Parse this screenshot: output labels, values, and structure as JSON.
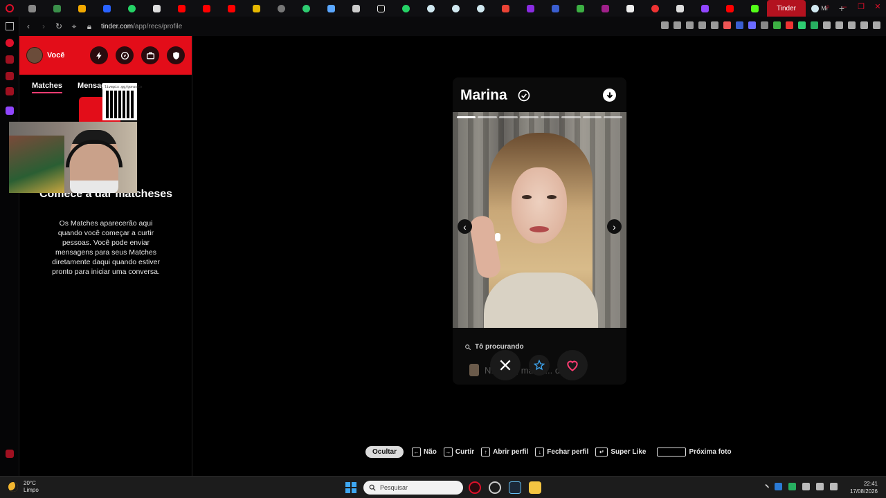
{
  "browser": {
    "active_tab": "Tinder",
    "last_tab": "Mi",
    "url_host": "tinder.com",
    "url_path": "/app/recs/profile"
  },
  "sidebar": {
    "user_label": "Você",
    "tabs": [
      "Matches",
      "Mensag"
    ],
    "empty_title": "Comece a dar matcheses",
    "empty_desc": "Os Matches aparecerão aqui quando você começar a curtir pessoas. Você pode enviar mensagens para seus Matches diretamente daqui quando estiver pronto para iniciar uma conversa.",
    "qr_label": "livepix.gg/gonzalo"
  },
  "profile": {
    "name": "Marina",
    "looking_label": "Tô procurando",
    "bio_preview": "N... ério, mas c... de...",
    "photo_count": 8,
    "current_photo": 1
  },
  "hints": {
    "hide": "Ocultar",
    "nope": "Não",
    "like": "Curtir",
    "open": "Abrir perfil",
    "close": "Fechar perfil",
    "super": "Super Like",
    "next": "Próxima foto"
  },
  "taskbar": {
    "temp": "20°C",
    "weather": "Limpo",
    "search_placeholder": "Pesquisar",
    "time": "22:41",
    "date": "17/08/2026"
  },
  "colors": {
    "brand": "#e30d19",
    "like": "#fe3c72",
    "super": "#3ea7f2"
  }
}
